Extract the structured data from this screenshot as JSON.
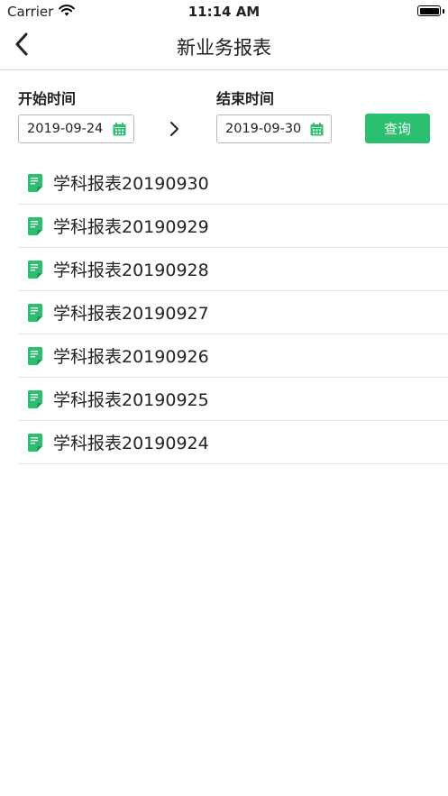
{
  "status_bar": {
    "carrier": "Carrier",
    "time": "11:14 AM"
  },
  "nav": {
    "title": "新业务报表",
    "back_icon": "chevron-left-icon"
  },
  "filters": {
    "start_label": "开始时间",
    "start_date": "2019-09-24",
    "end_label": "结束时间",
    "end_date": "2019-09-30",
    "query_label": "查询"
  },
  "reports": [
    {
      "label": "学科报表20190930"
    },
    {
      "label": "学科报表20190929"
    },
    {
      "label": "学科报表20190928"
    },
    {
      "label": "学科报表20190927"
    },
    {
      "label": "学科报表20190926"
    },
    {
      "label": "学科报表20190925"
    },
    {
      "label": "学科报表20190924"
    }
  ],
  "colors": {
    "accent": "#2ac06f"
  }
}
